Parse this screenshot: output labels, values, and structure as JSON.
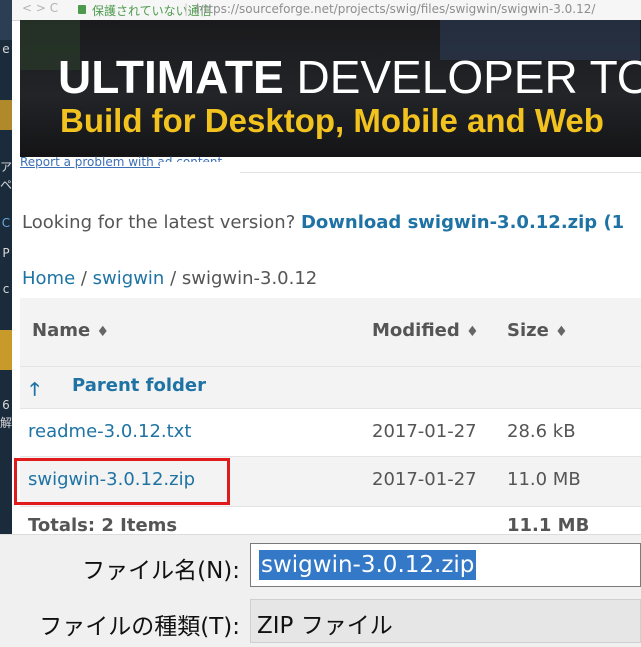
{
  "browser": {
    "nav_glyphs": "< > C",
    "security_status": "保護されていない通信",
    "url": "https://sourceforge.net/projects/swig/files/swigwin/swigwin-3.0.12/"
  },
  "ad": {
    "headline_bold": "ULTIMATE",
    "headline_rest": " DEVELOPER TOO",
    "subline": "Build for Desktop, Mobile and Web",
    "report_link": "Report a problem with ad content"
  },
  "notice": {
    "text": "Looking for the latest version? ",
    "download_link": "Download swigwin-3.0.12.zip (1"
  },
  "breadcrumb": {
    "home": "Home",
    "sep1": " / ",
    "folder": "swigwin",
    "sep2": " / ",
    "current": "swigwin-3.0.12"
  },
  "table": {
    "headers": {
      "name": "Name",
      "modified": "Modified",
      "size": "Size",
      "sort_glyph": "♦"
    },
    "parent": {
      "arrow": "🡑",
      "label": "Parent folder"
    },
    "rows": [
      {
        "name": "readme-3.0.12.txt",
        "modified": "2017-01-27",
        "size": "28.6 kB"
      },
      {
        "name": "swigwin-3.0.12.zip",
        "modified": "2017-01-27",
        "size": "11.0 MB"
      }
    ],
    "totals": {
      "label": "Totals: 2 Items",
      "size": "11.1 MB"
    }
  },
  "left_strip_glyphs": [
    "e",
    "ア",
    "ペ",
    "C",
    "P",
    "c",
    "6",
    "解"
  ],
  "dialog": {
    "filename_label": "ファイル名(N):",
    "filename_value": "swigwin-3.0.12.zip",
    "filetype_label": "ファイルの種類(T):",
    "filetype_value": "ZIP ファイル"
  },
  "colors": {
    "link": "#1e73a4",
    "highlight_box": "#e01b1b",
    "selection": "#3479c8",
    "banner_accent": "#f2c21f"
  }
}
